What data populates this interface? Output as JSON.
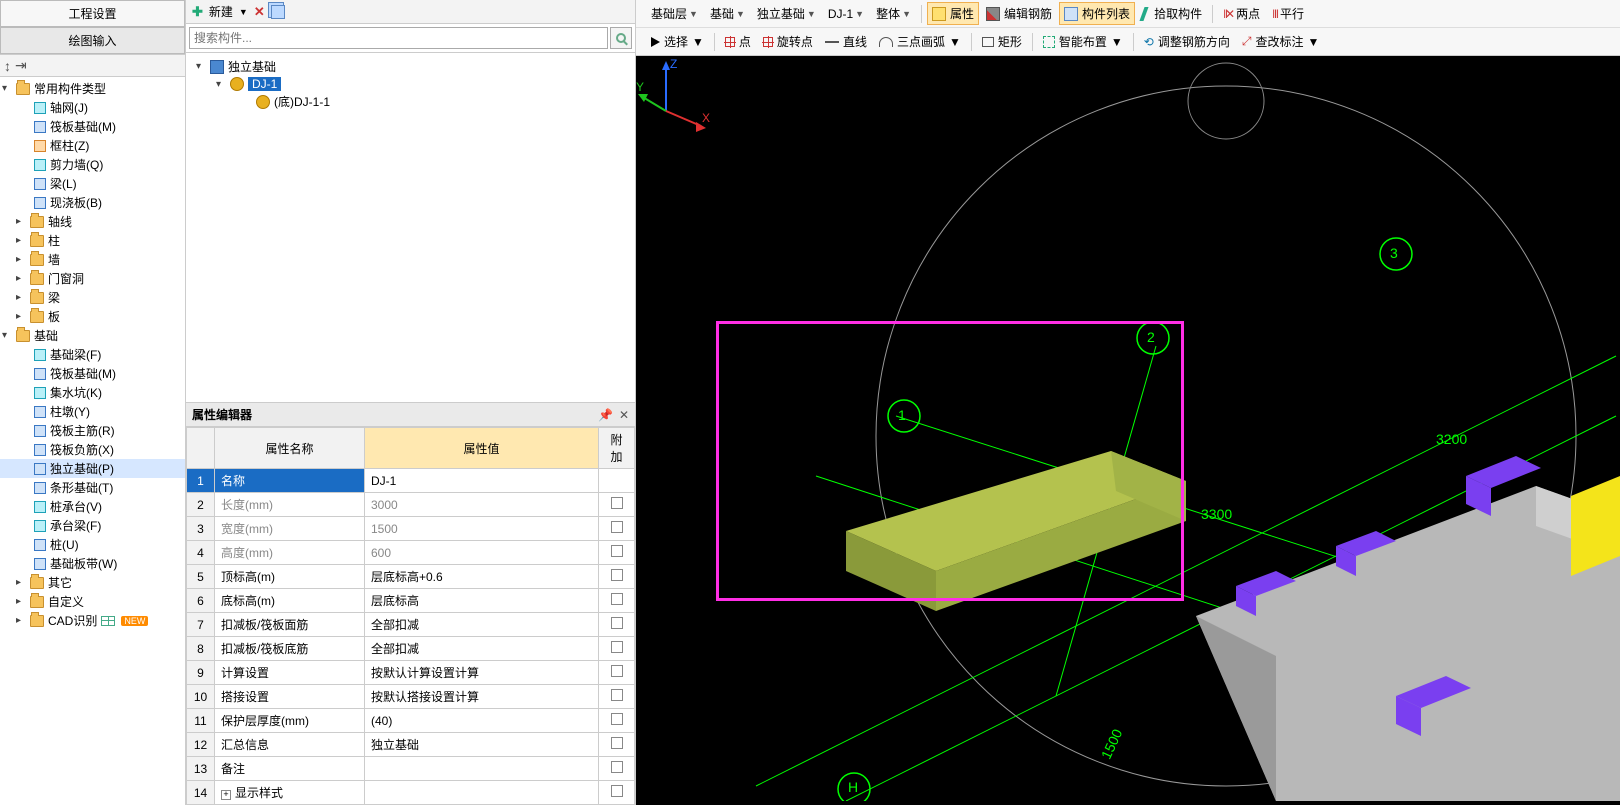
{
  "leftTabs": {
    "t0": "工程设置",
    "t1": "绘图输入"
  },
  "leftTree": {
    "n0": "常用构件类型",
    "n0_0": "轴网(J)",
    "n0_1": "筏板基础(M)",
    "n0_2": "框柱(Z)",
    "n0_3": "剪力墙(Q)",
    "n0_4": "梁(L)",
    "n0_5": "现浇板(B)",
    "n1": "轴线",
    "n2": "柱",
    "n3": "墙",
    "n4": "门窗洞",
    "n5": "梁",
    "n6": "板",
    "n7": "基础",
    "n7_0": "基础梁(F)",
    "n7_1": "筏板基础(M)",
    "n7_2": "集水坑(K)",
    "n7_3": "柱墩(Y)",
    "n7_4": "筏板主筋(R)",
    "n7_5": "筏板负筋(X)",
    "n7_6": "独立基础(P)",
    "n7_7": "条形基础(T)",
    "n7_8": "桩承台(V)",
    "n7_9": "承台梁(F)",
    "n7_10": "桩(U)",
    "n7_11": "基础板带(W)",
    "n8": "其它",
    "n9": "自定义",
    "n10": "CAD识别"
  },
  "midToolbar": {
    "new": "新建"
  },
  "search": {
    "placeholder": "搜索构件..."
  },
  "compTree": {
    "root": "独立基础",
    "child": "DJ-1",
    "leaf": "(底)DJ-1-1"
  },
  "propPanel": {
    "title": "属性编辑器",
    "hName": "属性名称",
    "hValue": "属性值",
    "hAttach": "附加",
    "rows": [
      {
        "i": "1",
        "n": "名称",
        "v": "DJ-1",
        "sel": true,
        "chk": false,
        "dim": false
      },
      {
        "i": "2",
        "n": "长度(mm)",
        "v": "3000",
        "dim": true,
        "chk": true
      },
      {
        "i": "3",
        "n": "宽度(mm)",
        "v": "1500",
        "dim": true,
        "chk": true
      },
      {
        "i": "4",
        "n": "高度(mm)",
        "v": "600",
        "dim": true,
        "chk": true
      },
      {
        "i": "5",
        "n": "顶标高(m)",
        "v": "层底标高+0.6",
        "chk": true
      },
      {
        "i": "6",
        "n": "底标高(m)",
        "v": "层底标高",
        "chk": true
      },
      {
        "i": "7",
        "n": "扣减板/筏板面筋",
        "v": "全部扣减",
        "chk": true
      },
      {
        "i": "8",
        "n": "扣减板/筏板底筋",
        "v": "全部扣减",
        "chk": true
      },
      {
        "i": "9",
        "n": "计算设置",
        "v": "按默认计算设置计算",
        "chk": true
      },
      {
        "i": "10",
        "n": "搭接设置",
        "v": "按默认搭接设置计算",
        "chk": true
      },
      {
        "i": "11",
        "n": "保护层厚度(mm)",
        "v": "(40)",
        "chk": true
      },
      {
        "i": "12",
        "n": "汇总信息",
        "v": "独立基础",
        "chk": true
      },
      {
        "i": "13",
        "n": "备注",
        "v": "",
        "chk": true
      },
      {
        "i": "14",
        "n": "显示样式",
        "v": "",
        "expand": true
      }
    ]
  },
  "vpTop": {
    "dd": [
      "基础层",
      "基础",
      "独立基础",
      "DJ-1",
      "整体"
    ],
    "btnProp": "属性",
    "btnRebar": "编辑钢筋",
    "btnList": "构件列表",
    "btnPick": "拾取构件",
    "btnTwo": "两点",
    "btnPar": "平行"
  },
  "vpBot": {
    "select": "选择",
    "point": "点",
    "rot": "旋转点",
    "line": "直线",
    "arc": "三点画弧",
    "rect": "矩形",
    "smart": "智能布置",
    "orient": "调整钢筋方向",
    "annot": "查改标注"
  },
  "scene": {
    "gridNums": {
      "n1": "1",
      "n2": "2",
      "n3": "3",
      "h": "H"
    },
    "dims": {
      "d1": "3200",
      "d2": "3300",
      "d3": "1500"
    },
    "axes": {
      "x": "X",
      "y": "Y",
      "z": "Z"
    }
  }
}
